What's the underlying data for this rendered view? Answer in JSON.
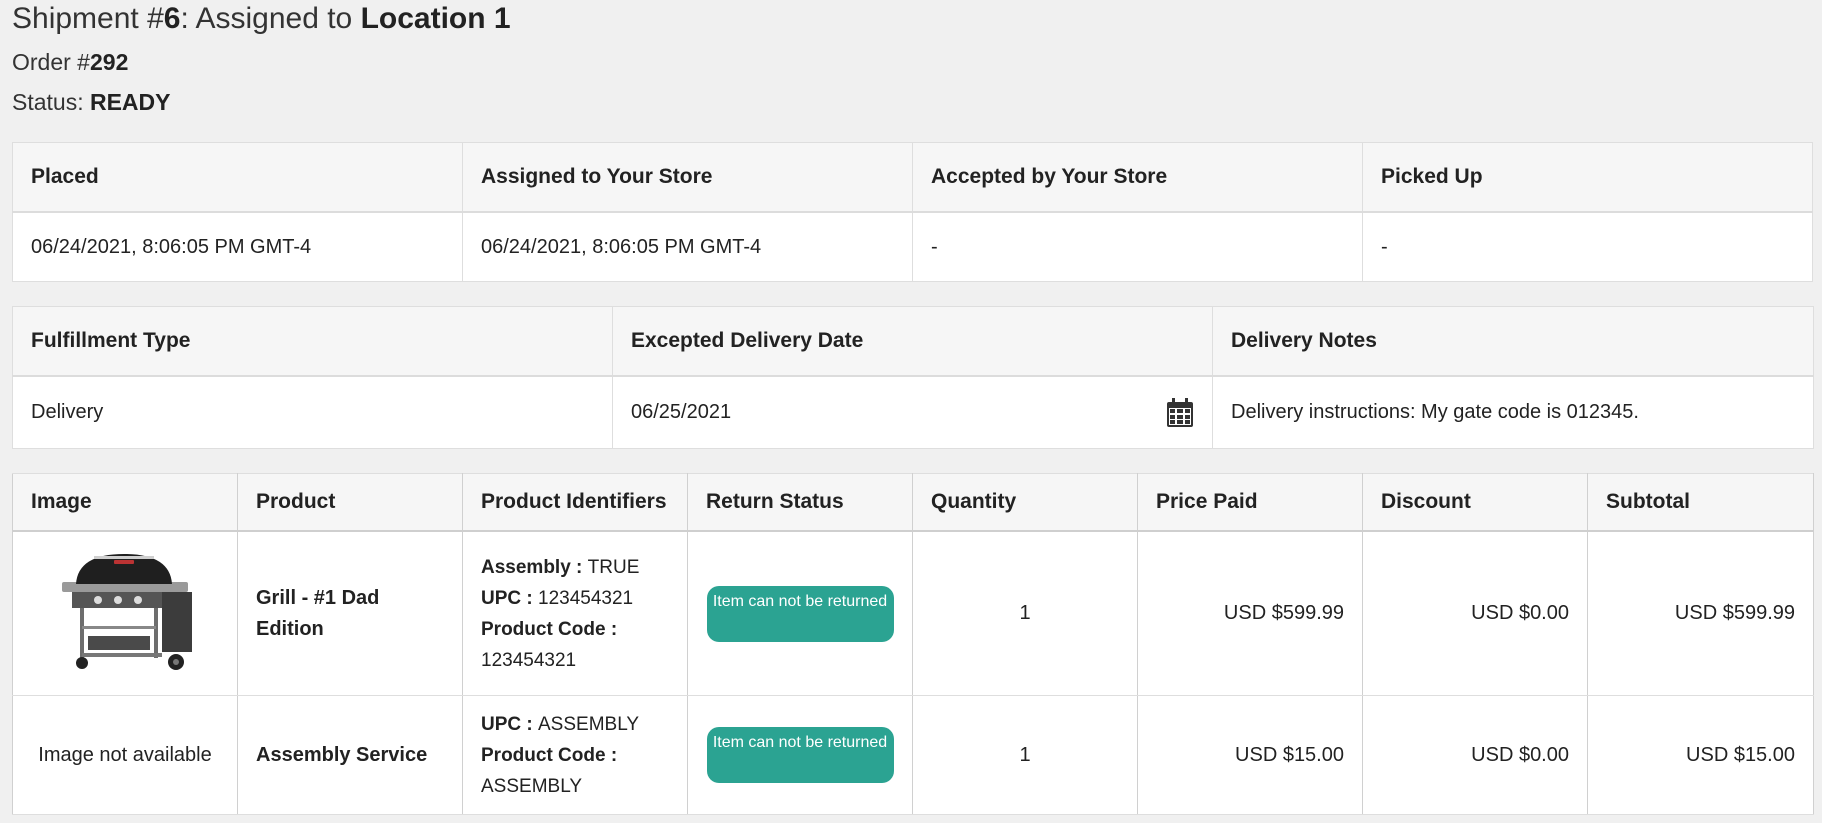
{
  "header": {
    "shipment_prefix": "Shipment #",
    "shipment_number": "6",
    "assigned_text": ": Assigned to ",
    "location": "Location 1",
    "order_prefix": "Order #",
    "order_number": "292",
    "status_prefix": "Status: ",
    "status_value": "READY"
  },
  "timeline": {
    "headers": [
      "Placed",
      "Assigned to Your Store",
      "Accepted by Your Store",
      "Picked Up"
    ],
    "values": [
      "06/24/2021, 8:06:05 PM GMT-4",
      "06/24/2021, 8:06:05 PM GMT-4",
      "-",
      "-"
    ]
  },
  "fulfillment": {
    "headers": [
      "Fulfillment Type",
      "Excepted Delivery Date",
      "Delivery Notes"
    ],
    "type": "Delivery",
    "date": "06/25/2021",
    "notes": "Delivery instructions: My gate code is 012345.",
    "calendar_icon": "calendar-icon"
  },
  "items": {
    "headers": [
      "Image",
      "Product",
      "Product Identifiers",
      "Return Status",
      "Quantity",
      "Price Paid",
      "Discount",
      "Subtotal"
    ],
    "rows": [
      {
        "image": "grill-image",
        "product": "Grill - #1 Dad Edition",
        "identifiers": [
          {
            "label": "Assembly : ",
            "value": "TRUE"
          },
          {
            "label": "UPC : ",
            "value": "123454321"
          },
          {
            "label": "Product Code : ",
            "value": "123454321"
          }
        ],
        "return_status": "Item can not be returned",
        "quantity": "1",
        "price_paid": "USD $599.99",
        "discount": "USD $0.00",
        "subtotal": "USD $599.99"
      },
      {
        "image_text": "Image not available",
        "product": "Assembly Service",
        "identifiers": [
          {
            "label": "UPC : ",
            "value": "ASSEMBLY"
          },
          {
            "label": "Product Code : ",
            "value": "ASSEMBLY"
          }
        ],
        "return_status": "Item can not be returned",
        "quantity": "1",
        "price_paid": "USD $15.00",
        "discount": "USD $0.00",
        "subtotal": "USD $15.00"
      }
    ]
  },
  "colors": {
    "badge": "#2ba392",
    "header_bg": "#f6f6f6",
    "page_bg": "#f0f0f0"
  }
}
